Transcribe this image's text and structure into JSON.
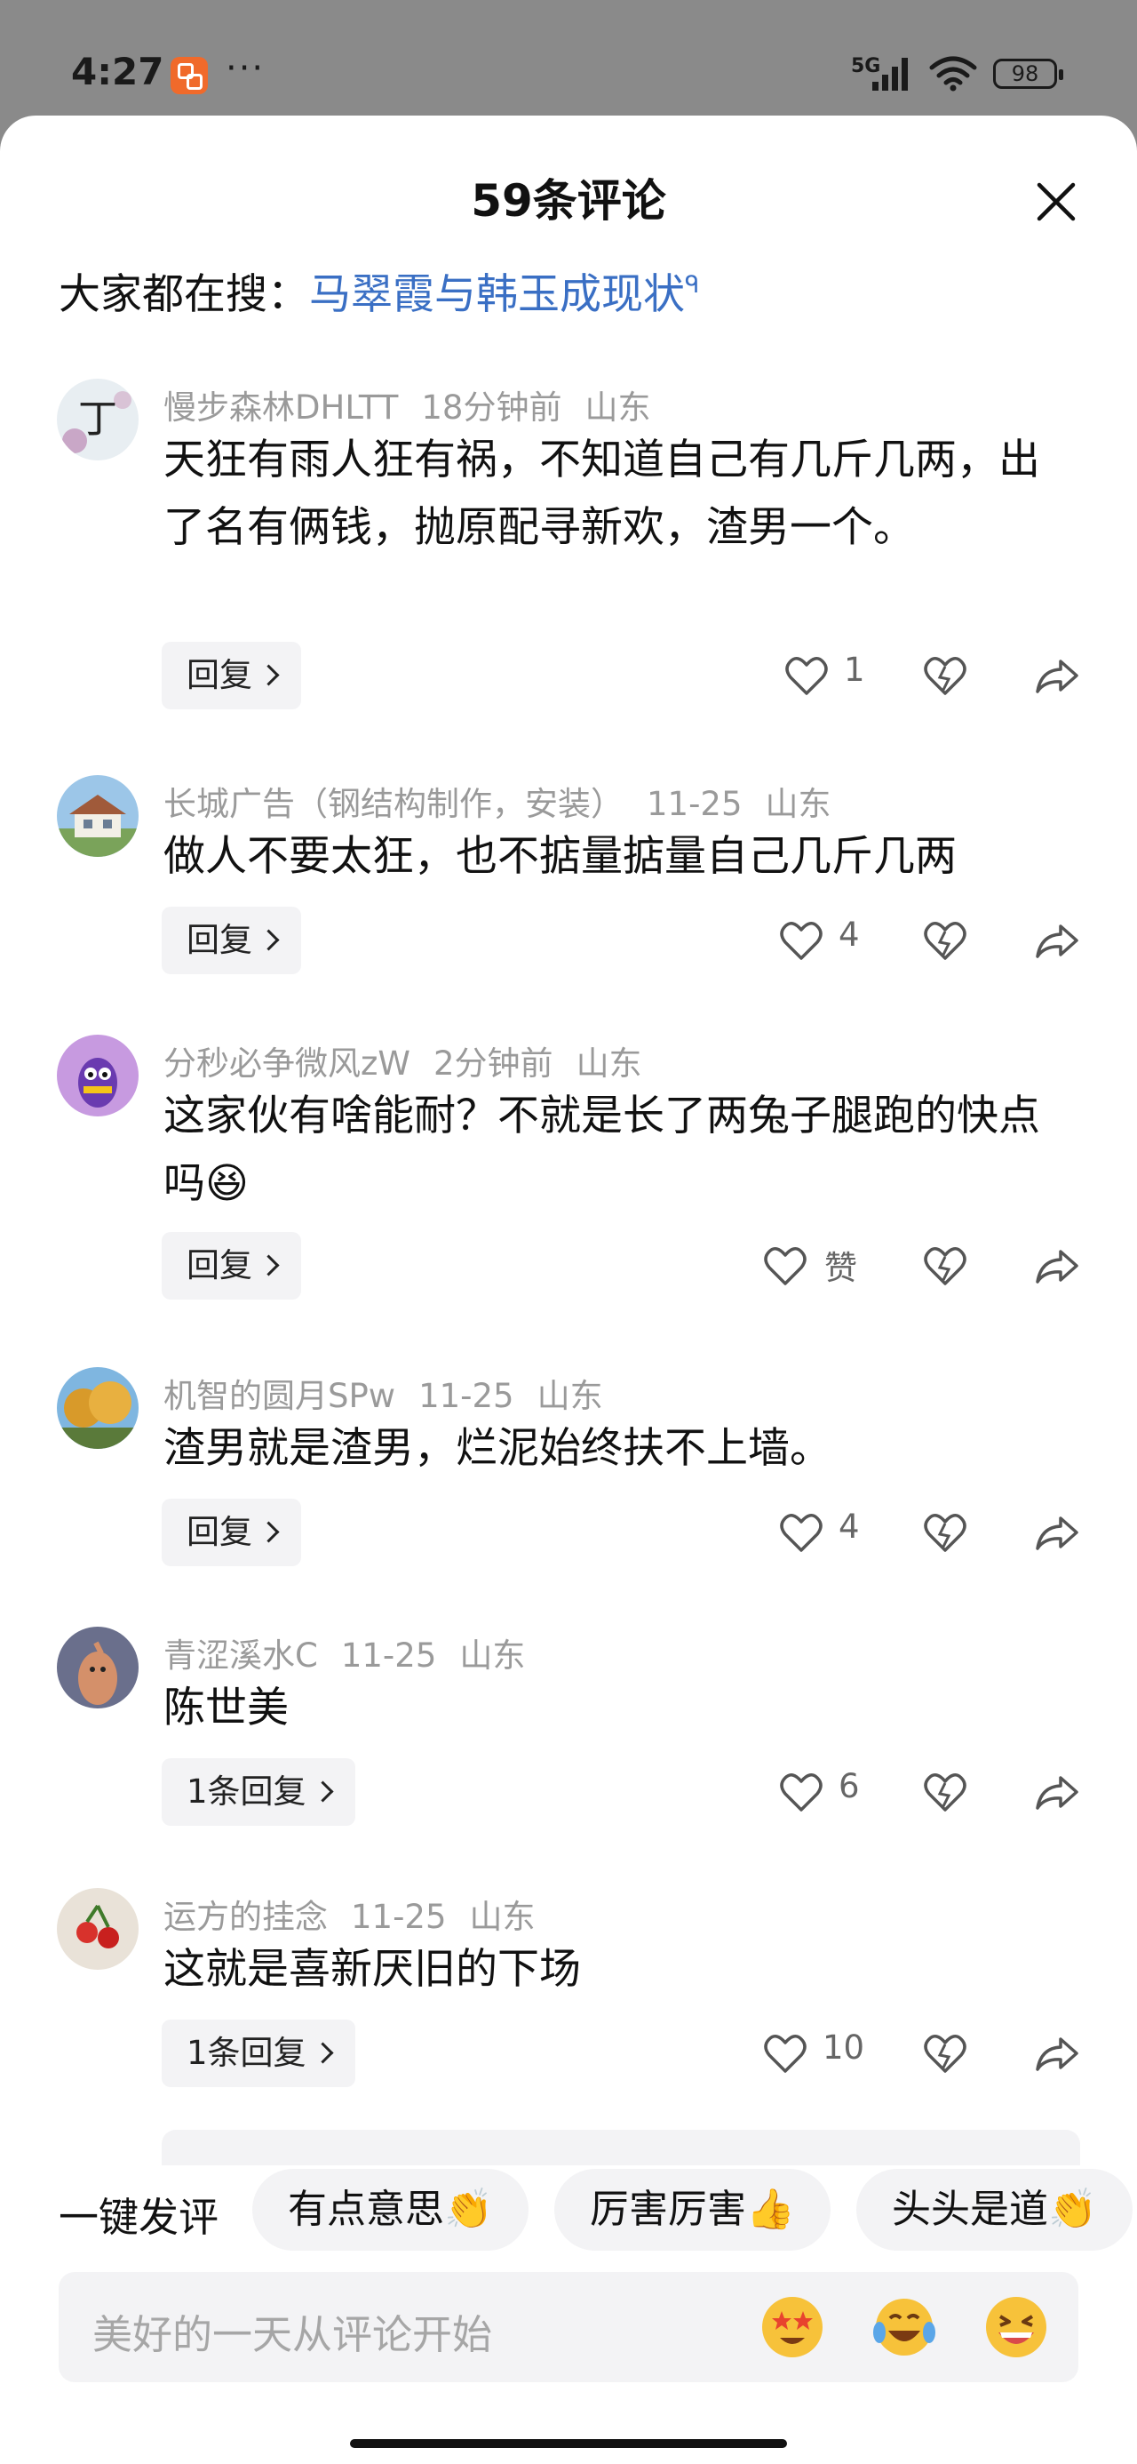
{
  "status_bar": {
    "time": "4:27",
    "dots": "···",
    "network": "5G",
    "battery": "98"
  },
  "sheet": {
    "title": "59条评论",
    "search_prefix": "大家都在搜：",
    "search_link": "马翠霞与韩玉成现状",
    "search_mark": "ᑫ"
  },
  "comments": [
    {
      "user": "慢步森林DHLTT",
      "time": "18分钟前",
      "location": "山东",
      "text": "天狂有雨人狂有祸，不知道自己有几斤几两，出了名有俩钱，抛原配寻新欢，渣男一个。",
      "reply_label": "回复",
      "likes": "1"
    },
    {
      "user": "长城广告（钢结构制作，安装）",
      "time": "11-25",
      "location": "山东",
      "text": "做人不要太狂，也不掂量掂量自己几斤几两",
      "reply_label": "回复",
      "likes": "4"
    },
    {
      "user": "分秒必争微风zW",
      "time": "2分钟前",
      "location": "山东",
      "text": "这家伙有啥能耐？不就是长了两兔子腿跑的快点吗😆",
      "reply_label": "回复",
      "likes": "赞"
    },
    {
      "user": "机智的圆月SPw",
      "time": "11-25",
      "location": "山东",
      "text": "渣男就是渣男，烂泥始终扶不上墙。",
      "reply_label": "回复",
      "likes": "4"
    },
    {
      "user": "青涩溪水C",
      "time": "11-25",
      "location": "山东",
      "text": "陈世美",
      "reply_label": "1条回复",
      "likes": "6"
    },
    {
      "user": "运方的挂念",
      "time": "11-25",
      "location": "山东",
      "text": "这就是喜新厌旧的下场",
      "reply_label": "1条回复",
      "likes": "10"
    }
  ],
  "quick_comment": {
    "label": "一键发评",
    "chips": [
      "有点意思👏",
      "厉害厉害👍",
      "头头是道👏"
    ]
  },
  "input": {
    "placeholder": "美好的一天从评论开始",
    "emojis": [
      "star-eyes-emoji",
      "laugh-cry-emoji",
      "grin-emoji"
    ]
  },
  "icons": [
    "close-icon",
    "heart-icon",
    "dislike-heart-icon",
    "share-icon",
    "chevron-right-icon"
  ],
  "colors": {
    "link": "#3a6fc4",
    "meta": "#9a9a9a",
    "chip_bg": "#f3f3f5"
  }
}
